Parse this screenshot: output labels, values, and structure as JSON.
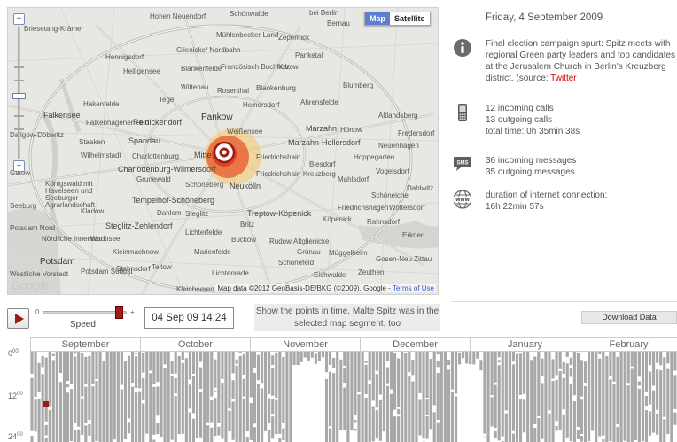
{
  "map": {
    "type_buttons": [
      "Map",
      "Satellite"
    ],
    "zoom_in": "+",
    "zoom_out": "−",
    "logo": "Google",
    "attribution": "Map data ©2012 GeoBasis-DE/BKG (©2009), Google - ",
    "terms": "Terms of Use",
    "places": [
      {
        "label": "Hohen Neuendorf"
      },
      {
        "label": "Schönwalde"
      },
      {
        "label": "bei Berlin"
      },
      {
        "label": "Bernau"
      },
      {
        "label": "Briesetang-Krämer"
      },
      {
        "label": "Mühlenbecker Land"
      },
      {
        "label": "Zepernick"
      },
      {
        "label": "Hennigsdorf"
      },
      {
        "label": "Glienicke/ Nordbahn"
      },
      {
        "label": "Panketal"
      },
      {
        "label": "Heiligensee"
      },
      {
        "label": "Blankenfelde"
      },
      {
        "label": "Französisch Buchholz"
      },
      {
        "label": "Karow"
      },
      {
        "label": "Wittenau"
      },
      {
        "label": "Rosenthal"
      },
      {
        "label": "Blankenburg"
      },
      {
        "label": "Blumberg"
      },
      {
        "label": "Hakenfelde"
      },
      {
        "label": "Tegel"
      },
      {
        "label": "Heinersdorf"
      },
      {
        "label": "Ahrensfelde"
      },
      {
        "label": "Falkensee"
      },
      {
        "label": "Falkenhagener Feld"
      },
      {
        "label": "Reinickendorf"
      },
      {
        "label": "Pankow"
      },
      {
        "label": "Dallgow-Döberitz"
      },
      {
        "label": "Weißensee"
      },
      {
        "label": "Marzahn"
      },
      {
        "label": "Hönow"
      },
      {
        "label": "Altlandsberg"
      },
      {
        "label": "Staaken"
      },
      {
        "label": "Spandau"
      },
      {
        "label": "Marzahn-Hellersdorf"
      },
      {
        "label": "Neuenhagen"
      },
      {
        "label": "Wilhelmstadt"
      },
      {
        "label": "Charlottenburg"
      },
      {
        "label": "Mitte"
      },
      {
        "label": "Friedrichshain"
      },
      {
        "label": "Hoppegarten"
      },
      {
        "label": "Charlottenburg-Wilmersdorf"
      },
      {
        "label": "Biesdorf"
      },
      {
        "label": "Gatow"
      },
      {
        "label": "Grunewald"
      },
      {
        "label": "Schöneberg"
      },
      {
        "label": "Friedrichshain-Kreuzberg"
      },
      {
        "label": "Vogelsdorf"
      },
      {
        "label": "Neukölln"
      },
      {
        "label": "Schöneiche"
      },
      {
        "label": "Tempelhof-Schöneberg"
      },
      {
        "label": "Woltersdorf"
      },
      {
        "label": "Kladow"
      },
      {
        "label": "Dahlem"
      },
      {
        "label": "Steglitz"
      },
      {
        "label": "Treptow-Köpenick"
      },
      {
        "label": "Köpenick"
      },
      {
        "label": "Friedrichshagen"
      },
      {
        "label": "Steglitz-Zehlendorf"
      },
      {
        "label": "Lichterfelde"
      },
      {
        "label": "Britz"
      },
      {
        "label": "Rahnsdorf"
      },
      {
        "label": "Potsdam Nord"
      },
      {
        "label": "Nördliche Innenstadt"
      },
      {
        "label": "Wannsee"
      },
      {
        "label": "Buckow"
      },
      {
        "label": "Rudow"
      },
      {
        "label": "Altglienicke"
      },
      {
        "label": "Erkner"
      },
      {
        "label": "Kleinmachnow"
      },
      {
        "label": "Marienfelde"
      },
      {
        "label": "Grünau"
      },
      {
        "label": "Müggelheim"
      },
      {
        "label": "Potsdam"
      },
      {
        "label": "Schönefeld"
      },
      {
        "label": "Gosen-Neu Zittau"
      },
      {
        "label": "Westliche Vorstadt"
      },
      {
        "label": "Potsdam Südost"
      },
      {
        "label": "Stahnsdorf"
      },
      {
        "label": "Teltow"
      },
      {
        "label": "Lichtenrade"
      },
      {
        "label": "Kleinbeeren"
      },
      {
        "label": "Eichwalde"
      },
      {
        "label": "Zeuthen"
      },
      {
        "label": "Dahlwitz"
      },
      {
        "label": "Fredersdorf"
      },
      {
        "label": "Mahlsdorf"
      },
      {
        "label": "Seeburg"
      },
      {
        "label": "Königswald mit Havelseen und Seeburger Agrarlandschaft"
      }
    ]
  },
  "info": {
    "date": "Friday, 4 September 2009",
    "event_text": "Final election campaign spurt: Spitz meets with regional Green party leaders and top candidates at the Jerusalem Church in Berlin's Kreuzberg district. (source: ",
    "event_source": "Twitter",
    "calls": [
      "12 incoming calls",
      "13 outgoing calls",
      "total time: 0h 35min 38s"
    ],
    "messages": [
      "36 incoming messages",
      "35 outgoing messages"
    ],
    "internet": [
      "duration of internet connection:",
      "16h 22min 57s"
    ],
    "sms_icon_label": "SMS",
    "www_icon_label": "WWW"
  },
  "controls": {
    "speed_label": "Speed",
    "speed_min": "0",
    "speed_max": "+",
    "speed_value": 0.92,
    "time": "04 Sep 09 14:24",
    "show_points": "Show the points in time, Malte Spitz was in the selected map segment, too",
    "download": "Download Data"
  },
  "timeline": {
    "months": [
      "September",
      "October",
      "November",
      "December",
      "January",
      "February"
    ],
    "hour_labels": [
      {
        "base": "0",
        "sup": "00"
      },
      {
        "base": "12",
        "sup": "00"
      },
      {
        "base": "24",
        "sup": "00"
      }
    ],
    "colors": {
      "active": "#a8a8a8",
      "empty": "#ffffff",
      "selected": "#9b1c12"
    }
  },
  "colors": {
    "accent": "#9b1c12",
    "map_button": "#5c7fd0",
    "source_link": "#cc0000"
  }
}
